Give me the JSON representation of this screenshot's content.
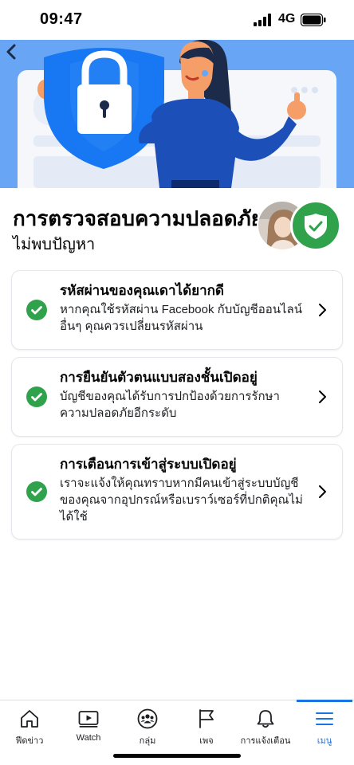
{
  "status_bar": {
    "time": "09:47",
    "network": "4G",
    "icons": [
      "signal-icon",
      "battery-icon"
    ]
  },
  "hero": {
    "icons": [
      "back-arrow-icon",
      "lock-shield-illustration"
    ]
  },
  "header": {
    "title": "การตรวจสอบความปลอดภัย",
    "subtitle": "ไม่พบปัญหา"
  },
  "cards": [
    {
      "title": "รหัสผ่านของคุณเดาได้ยากดี",
      "desc_lines": [
        "หากคุณใช้รหัสผ่าน Facebook กับบัญชีออนไลน์",
        "อื่นๆ คุณควรเปลี่ยนรหัสผ่าน"
      ]
    },
    {
      "title": "การยืนยันตัวตนแบบสองชั้นเปิดอยู่",
      "desc_lines": [
        "บัญชีของคุณได้รับการปกป้องด้วยการรักษา",
        "ความปลอดภัยอีกระดับ"
      ]
    },
    {
      "title": "การเตือนการเข้าสู่ระบบเปิดอยู่",
      "desc_lines": [
        "เราจะแจ้งให้คุณทราบหากมีคนเข้าสู่ระบบบัญชี",
        "ของคุณจากอุปกรณ์หรือเบราว์เซอร์ที่ปกติคุณไม่",
        "ได้ใช้"
      ]
    }
  ],
  "tabs": [
    {
      "label": "ฟีดข่าว",
      "icon": "home-icon"
    },
    {
      "label": "Watch",
      "icon": "watch-icon"
    },
    {
      "label": "กลุ่ม",
      "icon": "groups-icon"
    },
    {
      "label": "เพจ",
      "icon": "flag-icon"
    },
    {
      "label": "การแจ้งเตือน",
      "icon": "bell-icon"
    },
    {
      "label": "เมนู",
      "icon": "menu-icon",
      "active": true
    }
  ],
  "colors": {
    "accent": "#1b74e4",
    "success": "#31a24c",
    "hero_bg": "#68a6f5",
    "shield": "#1877f2"
  }
}
